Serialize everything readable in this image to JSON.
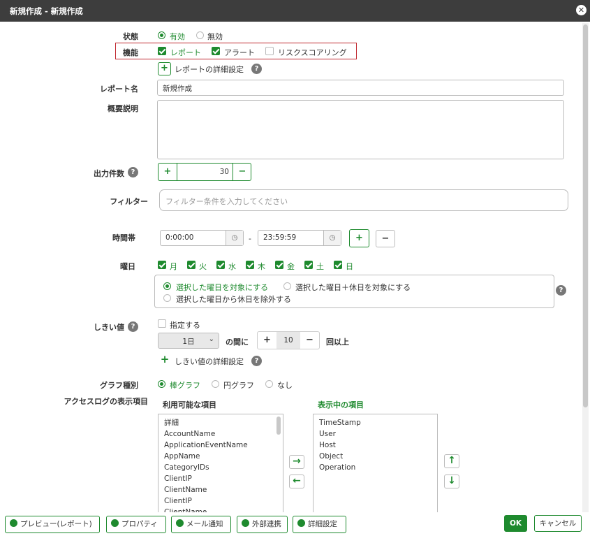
{
  "title": "新規作成 - 新規作成",
  "status": {
    "label": "状態",
    "on": "有効",
    "off": "無効"
  },
  "feature": {
    "label": "機能",
    "report": "レポート",
    "alert": "アラート",
    "risk": "リスクスコアリング"
  },
  "report_detail": "レポートの詳細設定",
  "report_name": {
    "label": "レポート名",
    "value": "新規作成"
  },
  "description": {
    "label": "概要説明",
    "value": ""
  },
  "output_count": {
    "label": "出力件数",
    "value": "30"
  },
  "filter": {
    "label": "フィルター",
    "placeholder": "フィルター条件を入力してください"
  },
  "time": {
    "label": "時間帯",
    "start": "0:00:00",
    "sep": "-",
    "end": "23:59:59"
  },
  "weekday": {
    "label": "曜日",
    "days": [
      "月",
      "火",
      "水",
      "木",
      "金",
      "土",
      "日"
    ],
    "opt1": "選択した曜日を対象にする",
    "opt2": "選択した曜日＋休日を対象にする",
    "opt3": "選択した曜日から休日を除外する"
  },
  "threshold": {
    "label": "しきい値",
    "specify": "指定する",
    "period": "1日",
    "between": "の間に",
    "count": "10",
    "times": "回以上",
    "detail": "しきい値の詳細設定"
  },
  "graph": {
    "label": "グラフ種別",
    "bar": "棒グラフ",
    "pie": "円グラフ",
    "none": "なし"
  },
  "access_log": {
    "label": "アクセスログの表示項目",
    "available_title": "利用可能な項目",
    "shown_title": "表示中の項目",
    "available": [
      "詳細",
      "AccountName",
      "ApplicationEventName",
      "AppName",
      "CategoryIDs",
      "ClientIP",
      "ClientName",
      "ClientIP",
      "ClientName"
    ],
    "shown": [
      "TimeStamp",
      "User",
      "Host",
      "Object",
      "Operation"
    ]
  },
  "footer": {
    "preview": "プレビュー(レポート)",
    "property": "プロパティ",
    "mail": "メール通知",
    "external": "外部連携",
    "detail": "詳細設定",
    "ok": "OK",
    "cancel": "キャンセル"
  }
}
